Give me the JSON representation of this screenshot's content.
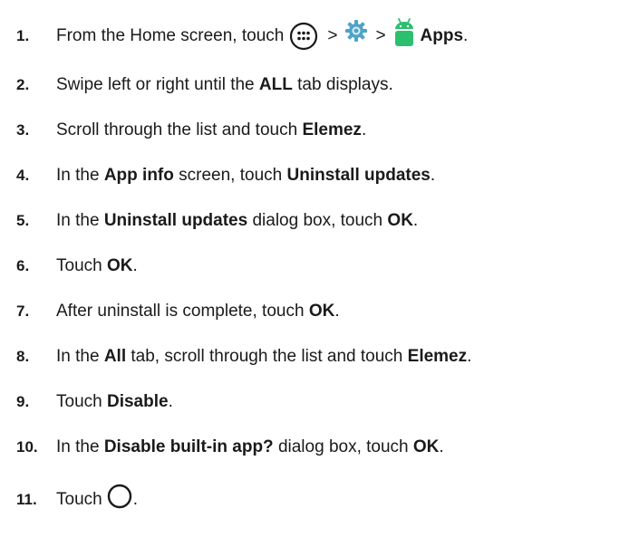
{
  "steps": [
    {
      "number": "1.",
      "parts": {
        "t1": "From the Home screen, touch",
        "sep1": ">",
        "sep2": ">",
        "b1": "Apps",
        "t2": "."
      },
      "icons": [
        "apps-grid-icon",
        "settings-gear-icon",
        "android-robot-icon"
      ]
    },
    {
      "number": "2.",
      "parts": {
        "t1": "Swipe left or right until the",
        "b1": "ALL",
        "t2": "tab displays."
      }
    },
    {
      "number": "3.",
      "parts": {
        "t1": "Scroll through the list and touch",
        "b1": "Elemez",
        "t2": "."
      }
    },
    {
      "number": "4.",
      "parts": {
        "t1": "In the",
        "b1": "App info",
        "t2": "screen, touch",
        "b2": "Uninstall updates",
        "t3": "."
      }
    },
    {
      "number": "5.",
      "parts": {
        "t1": "In the",
        "b1": "Uninstall updates",
        "t2": "dialog box, touch",
        "b2": "OK",
        "t3": "."
      }
    },
    {
      "number": "6.",
      "parts": {
        "t1": "Touch",
        "b1": "OK",
        "t2": "."
      }
    },
    {
      "number": "7.",
      "parts": {
        "t1": "After uninstall is complete, touch",
        "b1": "OK",
        "t2": "."
      }
    },
    {
      "number": "8.",
      "parts": {
        "t1": "In the",
        "b1": "All",
        "t2": "tab, scroll through the list and touch",
        "b2": "Elemez",
        "t3": "."
      }
    },
    {
      "number": "9.",
      "parts": {
        "t1": "Touch",
        "b1": "Disable",
        "t2": "."
      }
    },
    {
      "number": "10.",
      "parts": {
        "t1": "In the",
        "b1": "Disable built-in app?",
        "t2": "dialog box, touch",
        "b2": "OK",
        "t3": "."
      }
    },
    {
      "number": "11.",
      "parts": {
        "t1": "Touch",
        "t2": "."
      },
      "icons": [
        "home-circle-icon"
      ]
    }
  ],
  "colors": {
    "text": "#1a1a1a",
    "gear": "#4fa3c7",
    "robot": "#2bbf6e"
  }
}
